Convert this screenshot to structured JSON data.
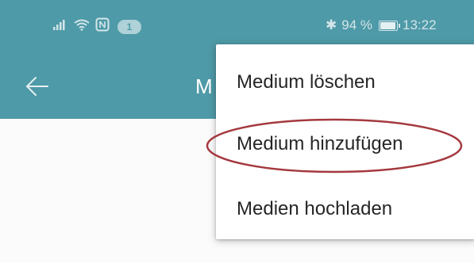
{
  "status_bar": {
    "notification_count": "1",
    "bluetooth_symbol": "✱",
    "battery_percent": "94 %",
    "battery_level": 0.94,
    "time": "13:22",
    "icons": [
      "signal-icon",
      "wifi-icon",
      "nfc-icon",
      "bluetooth-icon",
      "battery-icon"
    ]
  },
  "app_bar": {
    "title_visible": "M",
    "back_icon": "back-arrow-icon"
  },
  "menu": {
    "items": [
      {
        "label": "Medium löschen"
      },
      {
        "label": "Medium hinzufügen"
      },
      {
        "label": "Medien hochladen"
      }
    ]
  },
  "annotation": {
    "highlight_color": "#a4393f"
  },
  "colors": {
    "toolbar": "#4f9aa8",
    "menu_bg": "#ffffff",
    "text": "#262626",
    "screen_bg": "#fbfbfb"
  }
}
